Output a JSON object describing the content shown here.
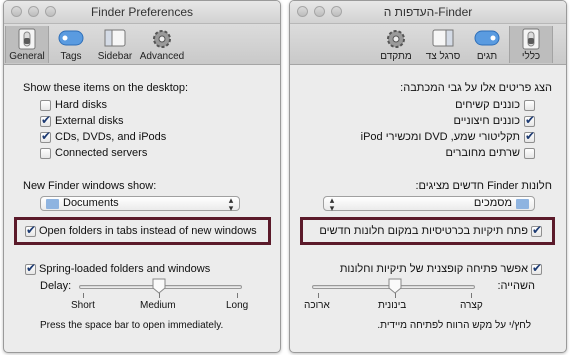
{
  "left_window": {
    "title": "Finder Preferences",
    "tabs": [
      {
        "label": "General",
        "icon": "general-switch-icon"
      },
      {
        "label": "Tags",
        "icon": "tags-icon"
      },
      {
        "label": "Sidebar",
        "icon": "sidebar-icon"
      },
      {
        "label": "Advanced",
        "icon": "gear-icon"
      }
    ],
    "desktop_heading": "Show these items on the desktop:",
    "desktop_items": [
      {
        "label": "Hard disks",
        "checked": false
      },
      {
        "label": "External disks",
        "checked": true
      },
      {
        "label": "CDs, DVDs, and iPods",
        "checked": true
      },
      {
        "label": "Connected servers",
        "checked": false
      }
    ],
    "new_windows_label": "New Finder windows show:",
    "new_windows_value": "Documents",
    "open_in_tabs_label": "Open folders in tabs instead of new windows",
    "open_in_tabs_checked": true,
    "spring_loaded_label": "Spring-loaded folders and windows",
    "spring_loaded_checked": true,
    "delay_label": "Delay:",
    "delay_ticks": [
      "Short",
      "Medium",
      "Long"
    ],
    "delay_value": "Medium",
    "footnote": "Press the space bar to open immediately."
  },
  "right_window": {
    "title": "העדפות ה-Finder",
    "tabs": [
      {
        "label": "כללי",
        "icon": "general-switch-icon"
      },
      {
        "label": "תגים",
        "icon": "tags-icon"
      },
      {
        "label": "סרגל צד",
        "icon": "sidebar-icon"
      },
      {
        "label": "מתקדם",
        "icon": "gear-icon"
      }
    ],
    "desktop_heading": "הצג פריטים אלו על גבי המכתבה:",
    "desktop_items": [
      {
        "label": "כוננים קשיחים",
        "checked": false
      },
      {
        "label": "כוננים חיצוניים",
        "checked": true
      },
      {
        "label": "תקליטורי שמע, DVD ומכשירי iPod",
        "checked": true
      },
      {
        "label": "שרתים מחוברים",
        "checked": false
      }
    ],
    "new_windows_label": "חלונות Finder חדשים מציגים:",
    "new_windows_value": "מסמכים",
    "open_in_tabs_label": "פתח תיקיות בכרטיסיות במקום חלונות חדשים",
    "open_in_tabs_checked": true,
    "spring_loaded_label": "אפשר פתיחה קופצנית של תיקיות וחלונות",
    "spring_loaded_checked": true,
    "delay_label": "השהייה:",
    "delay_ticks": [
      "קצרה",
      "בינונית",
      "ארוכה"
    ],
    "delay_value": "בינונית",
    "footnote": "לחץ/י על מקש הרווח לפתיחה מיידית."
  },
  "colors": {
    "highlight_border": "#5b1a2a",
    "check_color": "#1c3a72",
    "tags_icon": "#5a9be0"
  }
}
